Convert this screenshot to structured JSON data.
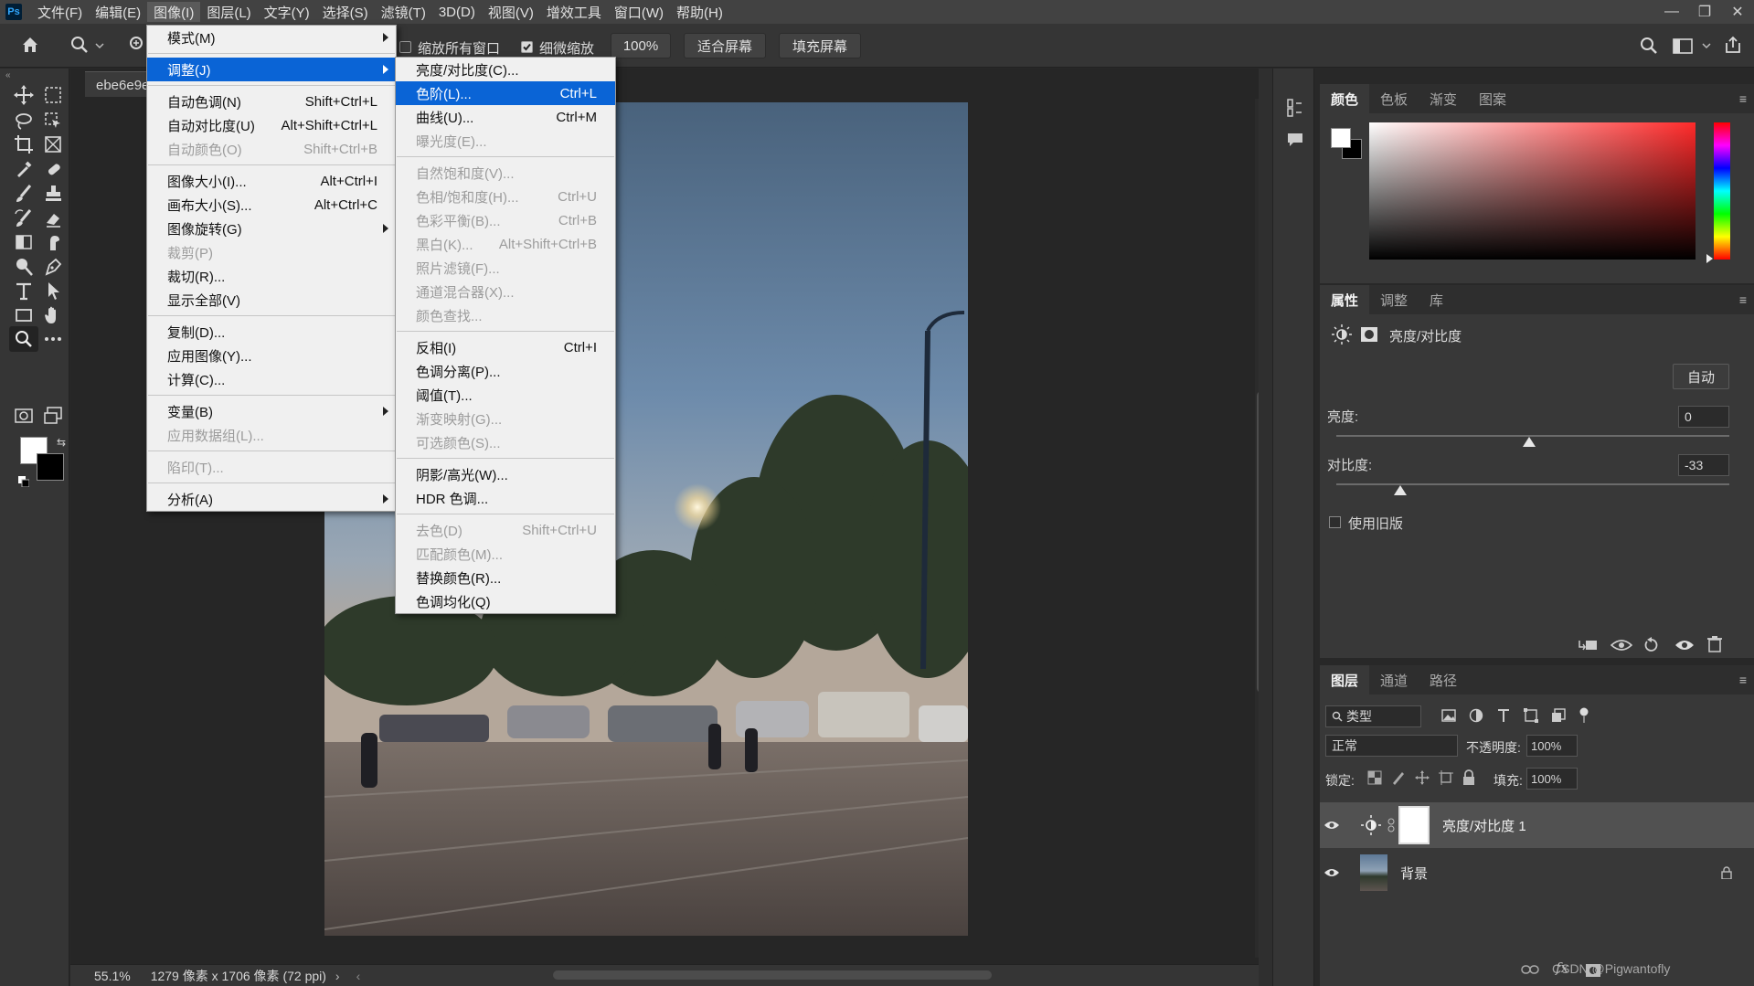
{
  "menubar": {
    "logo": "Ps",
    "items": [
      "文件(F)",
      "编辑(E)",
      "图像(I)",
      "图层(L)",
      "文字(Y)",
      "选择(S)",
      "滤镜(T)",
      "3D(D)",
      "视图(V)",
      "增效工具",
      "窗口(W)",
      "帮助(H)"
    ],
    "active_index": 2
  },
  "window_controls": {
    "minimize": "—",
    "restore": "❐",
    "close": "✕"
  },
  "options_bar": {
    "resize_windows_label": "缩放所有窗口",
    "scrubby_zoom_label": "细微缩放",
    "scrubby_zoom_checked": true,
    "zoom_value": "100%",
    "fit_screen": "适合屏幕",
    "fill_screen": "填充屏幕"
  },
  "document": {
    "tab_title": "ebe6e9e",
    "status_zoom": "55.1%",
    "status_info": "1279 像素 x 1706 像素 (72 ppi)"
  },
  "image_menu": {
    "items": [
      {
        "label": "模式(M)",
        "shortcut": "",
        "submenu": true,
        "disabled": false
      },
      {
        "sep": true
      },
      {
        "label": "调整(J)",
        "shortcut": "",
        "submenu": true,
        "disabled": false,
        "highlight": true
      },
      {
        "sep": true
      },
      {
        "label": "自动色调(N)",
        "shortcut": "Shift+Ctrl+L",
        "disabled": false
      },
      {
        "label": "自动对比度(U)",
        "shortcut": "Alt+Shift+Ctrl+L",
        "disabled": false
      },
      {
        "label": "自动颜色(O)",
        "shortcut": "Shift+Ctrl+B",
        "disabled": true
      },
      {
        "sep": true
      },
      {
        "label": "图像大小(I)...",
        "shortcut": "Alt+Ctrl+I",
        "disabled": false
      },
      {
        "label": "画布大小(S)...",
        "shortcut": "Alt+Ctrl+C",
        "disabled": false
      },
      {
        "label": "图像旋转(G)",
        "shortcut": "",
        "submenu": true,
        "disabled": false
      },
      {
        "label": "裁剪(P)",
        "shortcut": "",
        "disabled": true
      },
      {
        "label": "裁切(R)...",
        "shortcut": "",
        "disabled": false
      },
      {
        "label": "显示全部(V)",
        "shortcut": "",
        "disabled": false
      },
      {
        "sep": true
      },
      {
        "label": "复制(D)...",
        "shortcut": "",
        "disabled": false
      },
      {
        "label": "应用图像(Y)...",
        "shortcut": "",
        "disabled": false
      },
      {
        "label": "计算(C)...",
        "shortcut": "",
        "disabled": false
      },
      {
        "sep": true
      },
      {
        "label": "变量(B)",
        "shortcut": "",
        "submenu": true,
        "disabled": false
      },
      {
        "label": "应用数据组(L)...",
        "shortcut": "",
        "disabled": true
      },
      {
        "sep": true
      },
      {
        "label": "陷印(T)...",
        "shortcut": "",
        "disabled": true
      },
      {
        "sep": true
      },
      {
        "label": "分析(A)",
        "shortcut": "",
        "submenu": true,
        "disabled": false
      }
    ]
  },
  "adjust_menu": {
    "items": [
      {
        "label": "亮度/对比度(C)...",
        "shortcut": "",
        "disabled": false
      },
      {
        "label": "色阶(L)...",
        "shortcut": "Ctrl+L",
        "disabled": false,
        "highlight": true
      },
      {
        "label": "曲线(U)...",
        "shortcut": "Ctrl+M",
        "disabled": false
      },
      {
        "label": "曝光度(E)...",
        "shortcut": "",
        "disabled": true
      },
      {
        "sep": true
      },
      {
        "label": "自然饱和度(V)...",
        "shortcut": "",
        "disabled": true
      },
      {
        "label": "色相/饱和度(H)...",
        "shortcut": "Ctrl+U",
        "disabled": true
      },
      {
        "label": "色彩平衡(B)...",
        "shortcut": "Ctrl+B",
        "disabled": true
      },
      {
        "label": "黑白(K)...",
        "shortcut": "Alt+Shift+Ctrl+B",
        "disabled": true
      },
      {
        "label": "照片滤镜(F)...",
        "shortcut": "",
        "disabled": true
      },
      {
        "label": "通道混合器(X)...",
        "shortcut": "",
        "disabled": true
      },
      {
        "label": "颜色查找...",
        "shortcut": "",
        "disabled": true
      },
      {
        "sep": true
      },
      {
        "label": "反相(I)",
        "shortcut": "Ctrl+I",
        "disabled": false
      },
      {
        "label": "色调分离(P)...",
        "shortcut": "",
        "disabled": false
      },
      {
        "label": "阈值(T)...",
        "shortcut": "",
        "disabled": false
      },
      {
        "label": "渐变映射(G)...",
        "shortcut": "",
        "disabled": true
      },
      {
        "label": "可选颜色(S)...",
        "shortcut": "",
        "disabled": true
      },
      {
        "sep": true
      },
      {
        "label": "阴影/高光(W)...",
        "shortcut": "",
        "disabled": false
      },
      {
        "label": "HDR 色调...",
        "shortcut": "",
        "disabled": false
      },
      {
        "sep": true
      },
      {
        "label": "去色(D)",
        "shortcut": "Shift+Ctrl+U",
        "disabled": true
      },
      {
        "label": "匹配颜色(M)...",
        "shortcut": "",
        "disabled": true
      },
      {
        "label": "替换颜色(R)...",
        "shortcut": "",
        "disabled": false
      },
      {
        "label": "色调均化(Q)",
        "shortcut": "",
        "disabled": false
      }
    ]
  },
  "color_panel": {
    "tabs": [
      "颜色",
      "色板",
      "渐变",
      "图案"
    ],
    "active_tab": 0,
    "hue_color": "#ff2a2a"
  },
  "properties_panel": {
    "tabs": [
      "属性",
      "调整",
      "库"
    ],
    "active_tab": 0,
    "title": "亮度/对比度",
    "auto_button": "自动",
    "brightness_label": "亮度:",
    "brightness_value": "0",
    "contrast_label": "对比度:",
    "contrast_value": "-33",
    "legacy_label": "使用旧版"
  },
  "layers_panel": {
    "tabs": [
      "图层",
      "通道",
      "路径"
    ],
    "active_tab": 0,
    "filter_label": "类型",
    "blend_mode": "正常",
    "opacity_label": "不透明度:",
    "opacity_value": "100%",
    "lock_label": "锁定:",
    "fill_label": "填充:",
    "fill_value": "100%",
    "layers": [
      {
        "name": "亮度/对比度 1",
        "selected": true
      },
      {
        "name": "背景",
        "selected": false
      }
    ],
    "footer_fx": "fx",
    "watermark": "CSDN @Pigwantofly"
  },
  "colors": {
    "menu_highlight": "#0a64d6",
    "panel_bg": "#383838",
    "app_bg": "#282828"
  }
}
